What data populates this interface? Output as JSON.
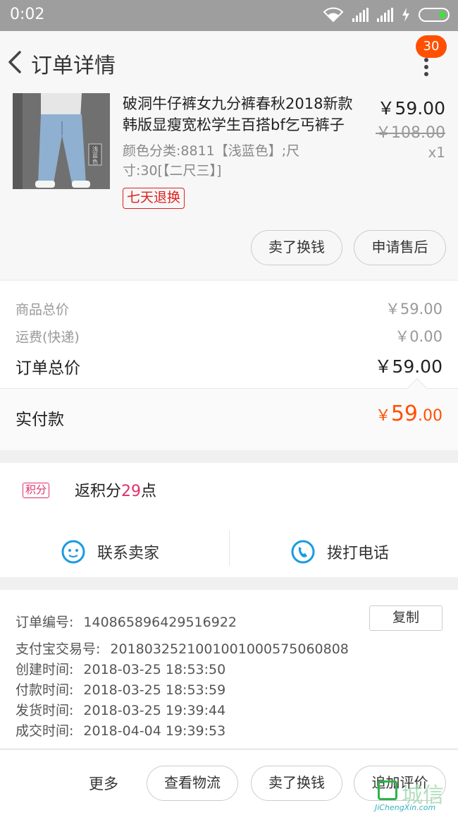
{
  "status_bar": {
    "time": "0:02"
  },
  "header": {
    "title": "订单详情",
    "badge_count": "30"
  },
  "product": {
    "name": "破洞牛仔裤女九分裤春秋2018新款韩版显瘦宽松学生百搭bf乞丐裤子",
    "spec": "颜色分类:8811【浅蓝色】;尺寸:30[【二尺三】]",
    "image_label": "浅蓝色",
    "tag": "七天退换",
    "price": "￥59.00",
    "original_price": "￥108.00",
    "quantity": "x1",
    "actions": {
      "sell": "卖了换钱",
      "after_sale": "申请售后"
    }
  },
  "summary": {
    "goods_total_label": "商品总价",
    "goods_total": "￥59.00",
    "shipping_label": "运费(快递)",
    "shipping": "￥0.00",
    "order_total_label": "订单总价",
    "order_total": "￥59.00",
    "paid_label": "实付款",
    "paid_symbol": "￥",
    "paid_int": "59",
    "paid_dec": ".00"
  },
  "points": {
    "badge": "积分",
    "prefix": "返积分",
    "value": "29",
    "suffix": "点"
  },
  "contact": {
    "seller": "联系卖家",
    "phone": "拨打电话"
  },
  "order_info": {
    "copy_label": "复制",
    "rows": [
      {
        "label": "订单编号:",
        "value": "140865896429516922"
      },
      {
        "label": "支付宝交易号:",
        "value": "2018032521001001000575060808"
      },
      {
        "label": "创建时间:",
        "value": "2018-03-25 18:53:50"
      },
      {
        "label": "付款时间:",
        "value": "2018-03-25 18:53:59"
      },
      {
        "label": "发货时间:",
        "value": "2018-03-25 19:39:44"
      },
      {
        "label": "成交时间:",
        "value": "2018-04-04 19:39:53"
      }
    ]
  },
  "bottom_bar": {
    "more": "更多",
    "logistics": "查看物流",
    "sell": "卖了换钱",
    "review": "追加评价"
  },
  "watermark": {
    "cn": "城信",
    "en": "JiChengXin.com"
  },
  "colors": {
    "accent": "#ff5000",
    "points": "#e0306a",
    "link_blue": "#1a9be0",
    "tag_red": "#e02020"
  }
}
